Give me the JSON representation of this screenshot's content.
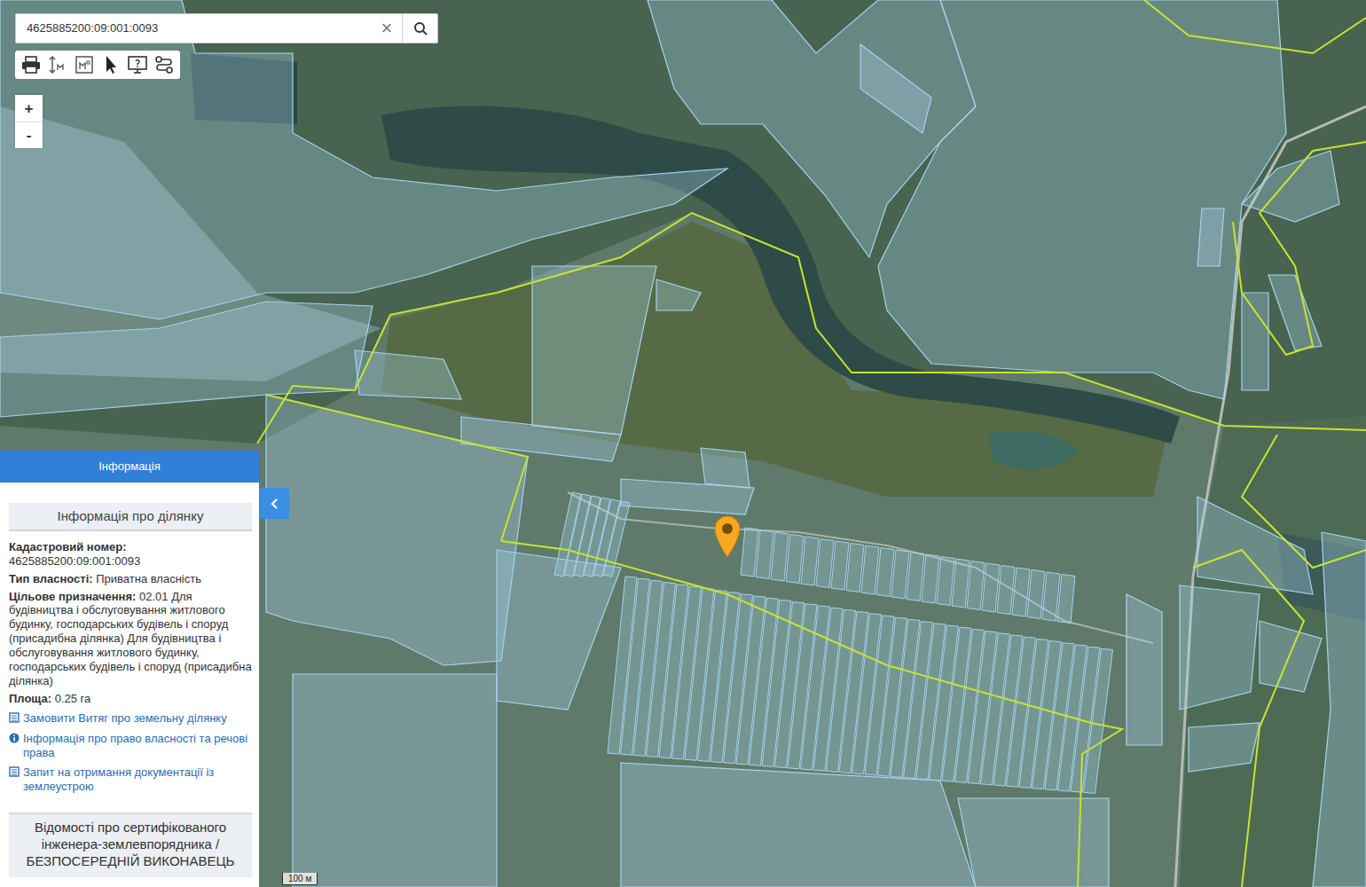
{
  "search": {
    "value": "4625885200:09:001:0093",
    "clear": "×"
  },
  "zoom": {
    "in": "+",
    "out": "-"
  },
  "panel": {
    "title": "Інформація",
    "section_title": "Інформація про ділянку",
    "fields": [
      {
        "label": "Кадастровий номер:",
        "value": "4625885200:09:001:0093",
        "kind": "block"
      },
      {
        "label": "Тип власності:",
        "value": "Приватна власність",
        "kind": "inline"
      },
      {
        "label": "Цільове призначення:",
        "value": "02.01 Для будівництва і обслуговування житлового будинку, господарських будівель і споруд (присадибна ділянка) Для будівництва і обслуговування житлового будинку, господарських будівель і споруд (присадибна ділянка)",
        "kind": "inline"
      },
      {
        "label": "Площа:",
        "value": "0.25 га",
        "kind": "inline"
      }
    ],
    "links": [
      {
        "text": "Замовити Витяг про земельну ділянку",
        "kind": "document"
      },
      {
        "text": "Інформація про право власності та речові права",
        "kind": "info"
      },
      {
        "text": "Запит на отримання документації із землеустрою",
        "kind": "document"
      }
    ],
    "surveyor_title": "Відомості про сертифікованого інженера-землевпорядника / БЕЗПОСЕРЕДНІЙ ВИКОНАВЕЦЬ"
  },
  "map": {
    "scale": "100 м"
  }
}
